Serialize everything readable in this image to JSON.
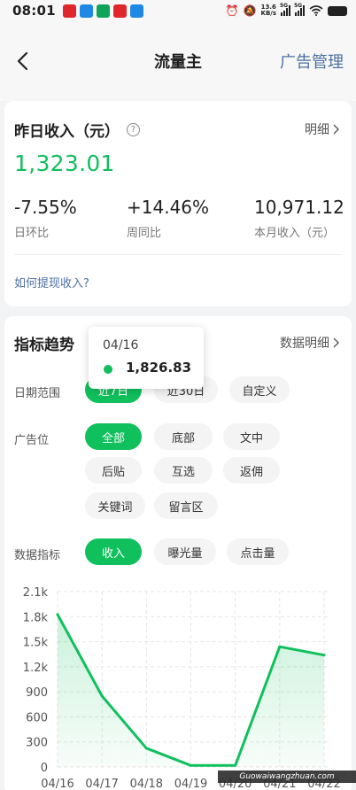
{
  "status_bar": {
    "time": "08:01",
    "net_speed_value": "13.6",
    "net_speed_unit": "KB/s",
    "signal1_label": "5G",
    "signal2_label": "5G",
    "notif_colors": [
      "#e0262d",
      "#1e88e5",
      "#12a35a",
      "#e0262d",
      "#1e88e5"
    ]
  },
  "nav": {
    "title": "流量主",
    "action": "广告管理"
  },
  "income": {
    "title": "昨日收入（元）",
    "detail_link": "明细",
    "amount": "1,323.01",
    "stats": [
      {
        "value": "-7.55%",
        "label": "日环比"
      },
      {
        "value": "+14.46%",
        "label": "周同比"
      },
      {
        "value": "10,971.12",
        "label": "本月收入（元）"
      }
    ],
    "withdraw_link": "如何提现收入?"
  },
  "trend": {
    "title": "指标趋势",
    "detail_link": "数据明细",
    "date_range": {
      "label": "日期范围",
      "options": [
        "近7日",
        "近30日",
        "自定义"
      ],
      "selected": "近7日"
    },
    "ad_position": {
      "label": "广告位",
      "options": [
        "全部",
        "底部",
        "文中",
        "后贴",
        "互选",
        "返佣",
        "关键词",
        "留言区"
      ],
      "selected": "全部"
    },
    "metric": {
      "label": "数据指标",
      "options": [
        "收入",
        "曝光量",
        "点击量"
      ],
      "selected": "收入"
    }
  },
  "chart_data": {
    "type": "area",
    "x": [
      "04/16",
      "04/17",
      "04/18",
      "04/19",
      "04/20",
      "04/21",
      "04/22"
    ],
    "series": [
      {
        "values": [
          1826.83,
          850,
          225,
          18,
          18,
          1440,
          1340
        ]
      }
    ],
    "y_ticks": [
      "0",
      "300",
      "600",
      "900",
      "1.2k",
      "1.5k",
      "1.8k",
      "2.1k"
    ],
    "ylim": [
      0,
      2100
    ],
    "grid": true,
    "color": "#10c05c",
    "tooltip": {
      "date": "04/16",
      "value": "1,826.83"
    }
  },
  "watermark": "Guowaiwangzhuan.com"
}
